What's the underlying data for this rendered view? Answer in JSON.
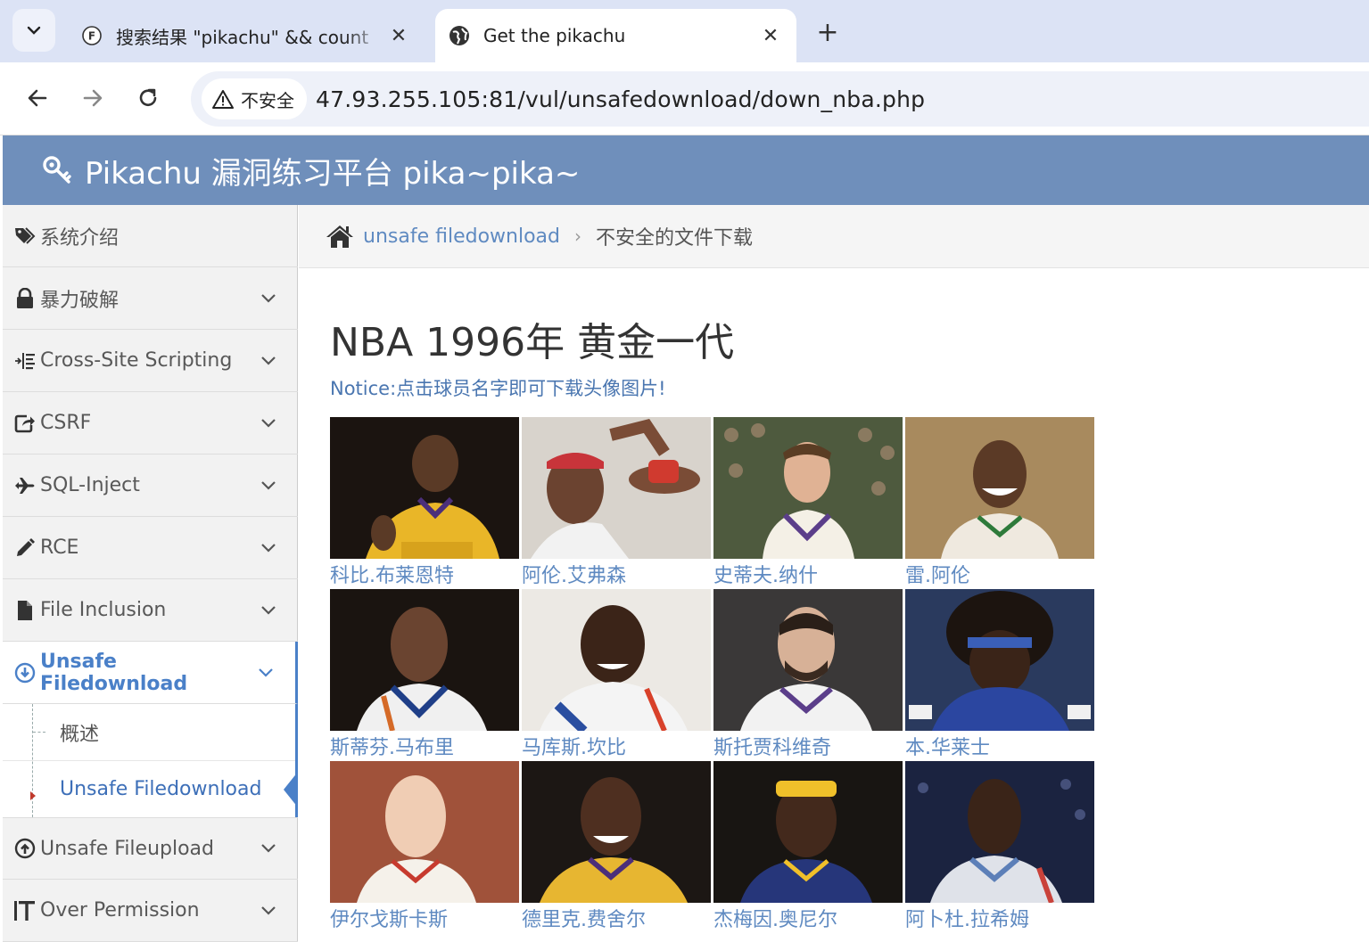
{
  "browser": {
    "tabs": [
      {
        "title": "搜索结果 \"pikachu\" && count",
        "favicon": "search-result-favicon",
        "active": false
      },
      {
        "title": "Get the pikachu",
        "favicon": "globe-icon",
        "active": true
      }
    ],
    "security_label": "不安全",
    "url": "47.93.255.105:81/vul/unsafedownload/down_nba.php"
  },
  "header": {
    "brand": "Pikachu 漏洞练习平台 pika~pika~"
  },
  "sidebar": {
    "items": [
      {
        "label": "系统介绍",
        "icon": "tags-icon",
        "expandable": false
      },
      {
        "label": "暴力破解",
        "icon": "lock-icon",
        "expandable": true
      },
      {
        "label": "Cross-Site Scripting",
        "icon": "indent-list-icon",
        "expandable": true
      },
      {
        "label": "CSRF",
        "icon": "share-square-icon",
        "expandable": true
      },
      {
        "label": "SQL-Inject",
        "icon": "fighter-jet-icon",
        "expandable": true
      },
      {
        "label": "RCE",
        "icon": "pencil-icon",
        "expandable": true
      },
      {
        "label": "File Inclusion",
        "icon": "file-icon",
        "expandable": true
      },
      {
        "label": "Unsafe Filedownload",
        "icon": "download-circle-icon",
        "expandable": true,
        "open": true
      },
      {
        "label": "Unsafe Fileupload",
        "icon": "upload-circle-icon",
        "expandable": true
      },
      {
        "label": "Over Permission",
        "icon": "text-height-icon",
        "expandable": true
      }
    ],
    "submenu": [
      {
        "label": "概述",
        "active": false
      },
      {
        "label": "Unsafe Filedownload",
        "active": true
      }
    ]
  },
  "breadcrumb": {
    "link": "unsafe filedownload",
    "current": "不安全的文件下载"
  },
  "main": {
    "title": "NBA 1996年 黄金一代",
    "notice": "Notice:点击球员名字即可下载头像图片!",
    "players": [
      {
        "name": "科比.布莱恩特"
      },
      {
        "name": "阿伦.艾弗森"
      },
      {
        "name": "史蒂夫.纳什"
      },
      {
        "name": "雷.阿伦"
      },
      {
        "name": "斯蒂芬.马布里"
      },
      {
        "name": "马库斯.坎比"
      },
      {
        "name": "斯托贾科维奇"
      },
      {
        "name": "本.华莱士"
      },
      {
        "name": "伊尔戈斯卡斯"
      },
      {
        "name": "德里克.费舍尔"
      },
      {
        "name": "杰梅因.奥尼尔"
      },
      {
        "name": "阿卜杜.拉希姆"
      }
    ]
  },
  "colors": {
    "header_bg": "#6f8fbb",
    "link": "#5f8ac1",
    "active_menu": "#4a80c8",
    "tabstrip_bg": "#dce3f5"
  }
}
